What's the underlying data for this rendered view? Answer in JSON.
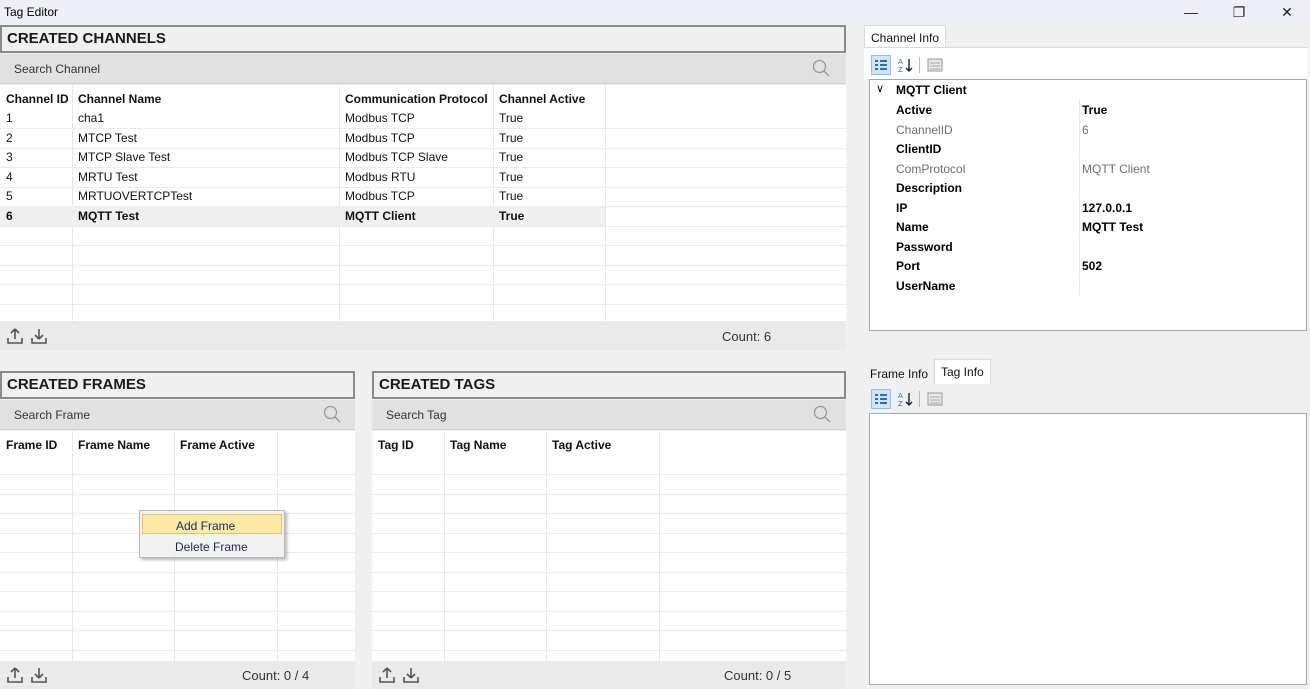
{
  "window": {
    "title": "Tag Editor",
    "minimize_glyph": "—",
    "restore_glyph": "❐",
    "close_glyph": "✕"
  },
  "channels": {
    "title": "CREATED CHANNELS",
    "search_placeholder": "Search Channel",
    "columns": [
      "Channel ID",
      "Channel Name",
      "Communication Protocol",
      "Channel Active"
    ],
    "rows": [
      [
        "1",
        "cha1",
        "Modbus TCP",
        "True"
      ],
      [
        "2",
        "MTCP Test",
        "Modbus TCP",
        "True"
      ],
      [
        "3",
        "MTCP Slave Test",
        "Modbus TCP Slave",
        "True"
      ],
      [
        "4",
        "MRTU Test",
        "Modbus RTU",
        "True"
      ],
      [
        "5",
        "MRTUOVERTCPTest",
        "Modbus TCP",
        "True"
      ],
      [
        "6",
        "MQTT Test",
        "MQTT Client",
        "True"
      ]
    ],
    "selected_row": 5,
    "count": "Count: 6"
  },
  "frames": {
    "title": "CREATED FRAMES",
    "search_placeholder": "Search Frame",
    "columns": [
      "Frame ID",
      "Frame Name",
      "Frame Active"
    ],
    "count": "Count: 0 / 4"
  },
  "tags": {
    "title": "CREATED TAGS",
    "search_placeholder": "Search Tag",
    "columns": [
      "Tag ID",
      "Tag Name",
      "Tag Active"
    ],
    "count": "Count: 0 / 5"
  },
  "channel_info": {
    "tab": "Channel Info",
    "category": "MQTT Client",
    "properties": [
      {
        "name": "Active",
        "value": "True",
        "style": "bold"
      },
      {
        "name": "ChannelID",
        "value": "6",
        "style": "grey"
      },
      {
        "name": "ClientID",
        "value": "",
        "style": "bold"
      },
      {
        "name": "ComProtocol",
        "value": "MQTT Client",
        "style": "grey"
      },
      {
        "name": "Description",
        "value": "",
        "style": "bold"
      },
      {
        "name": "IP",
        "value": "127.0.0.1",
        "style": "bold"
      },
      {
        "name": "Name",
        "value": "MQTT Test",
        "style": "bold"
      },
      {
        "name": "Password",
        "value": "",
        "style": "bold"
      },
      {
        "name": "Port",
        "value": "502",
        "style": "bold"
      },
      {
        "name": "UserName",
        "value": "",
        "style": "bold"
      }
    ]
  },
  "lower_info": {
    "tabs": [
      "Frame Info",
      "Tag Info"
    ],
    "active_tab": 1
  },
  "context_menu": {
    "items": [
      "Add Frame",
      "Delete Frame"
    ],
    "highlighted": 0
  },
  "colors": {
    "accent_selection": "#cfe4f7",
    "menu_highlight": "#fbe9a6"
  }
}
